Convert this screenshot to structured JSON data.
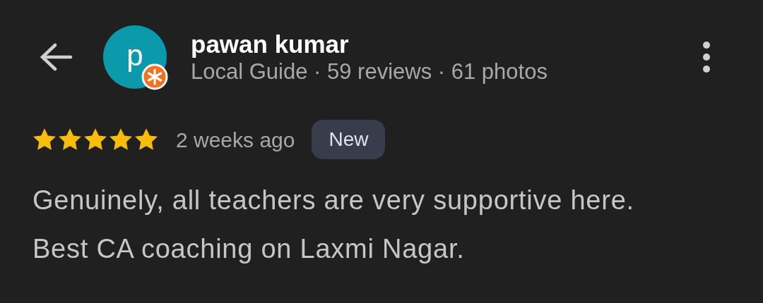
{
  "reviewer": {
    "avatar_letter": "p",
    "local_guide_badge": true,
    "name": "pawan kumar",
    "subtitle": "Local Guide · 59 reviews · 61 photos"
  },
  "review": {
    "stars": 5,
    "time": "2 weeks ago",
    "badge": "New",
    "text": "Genuinely, all teachers are very supportive here. Best CA coaching on Laxmi Nagar."
  }
}
